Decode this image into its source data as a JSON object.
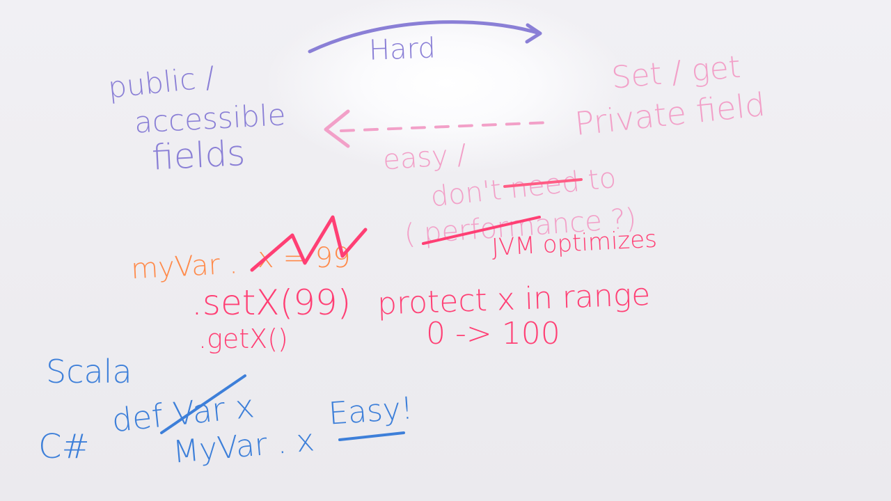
{
  "colors": {
    "purple": "#8a7fd6",
    "pink": "#f2a0c8",
    "hot_pink": "#ff3f74",
    "orange": "#ff8a4a",
    "blue": "#3d7fd9",
    "board": "#ecebef"
  },
  "notes": {
    "hard": "Hard",
    "public": "public /",
    "accessible": "accessible",
    "fields": "fields",
    "set_get": "Set / get",
    "private_field": "Private field",
    "easy": "easy /",
    "dont_need": "don't need to",
    "performance": "( performance ?)",
    "jvm": "JVM optimizes",
    "myvar_orange": "myVar .",
    "myvar_struck": "x = 99",
    "setx": ".setX(99)",
    "getx": ".getX()",
    "protect": "protect x in range",
    "range": "0 -> 100",
    "scala": "Scala",
    "defvar": "def Var x",
    "csharp": "C#",
    "myvar_blue": "MyVar . x",
    "easy_bang": "Easy!"
  }
}
